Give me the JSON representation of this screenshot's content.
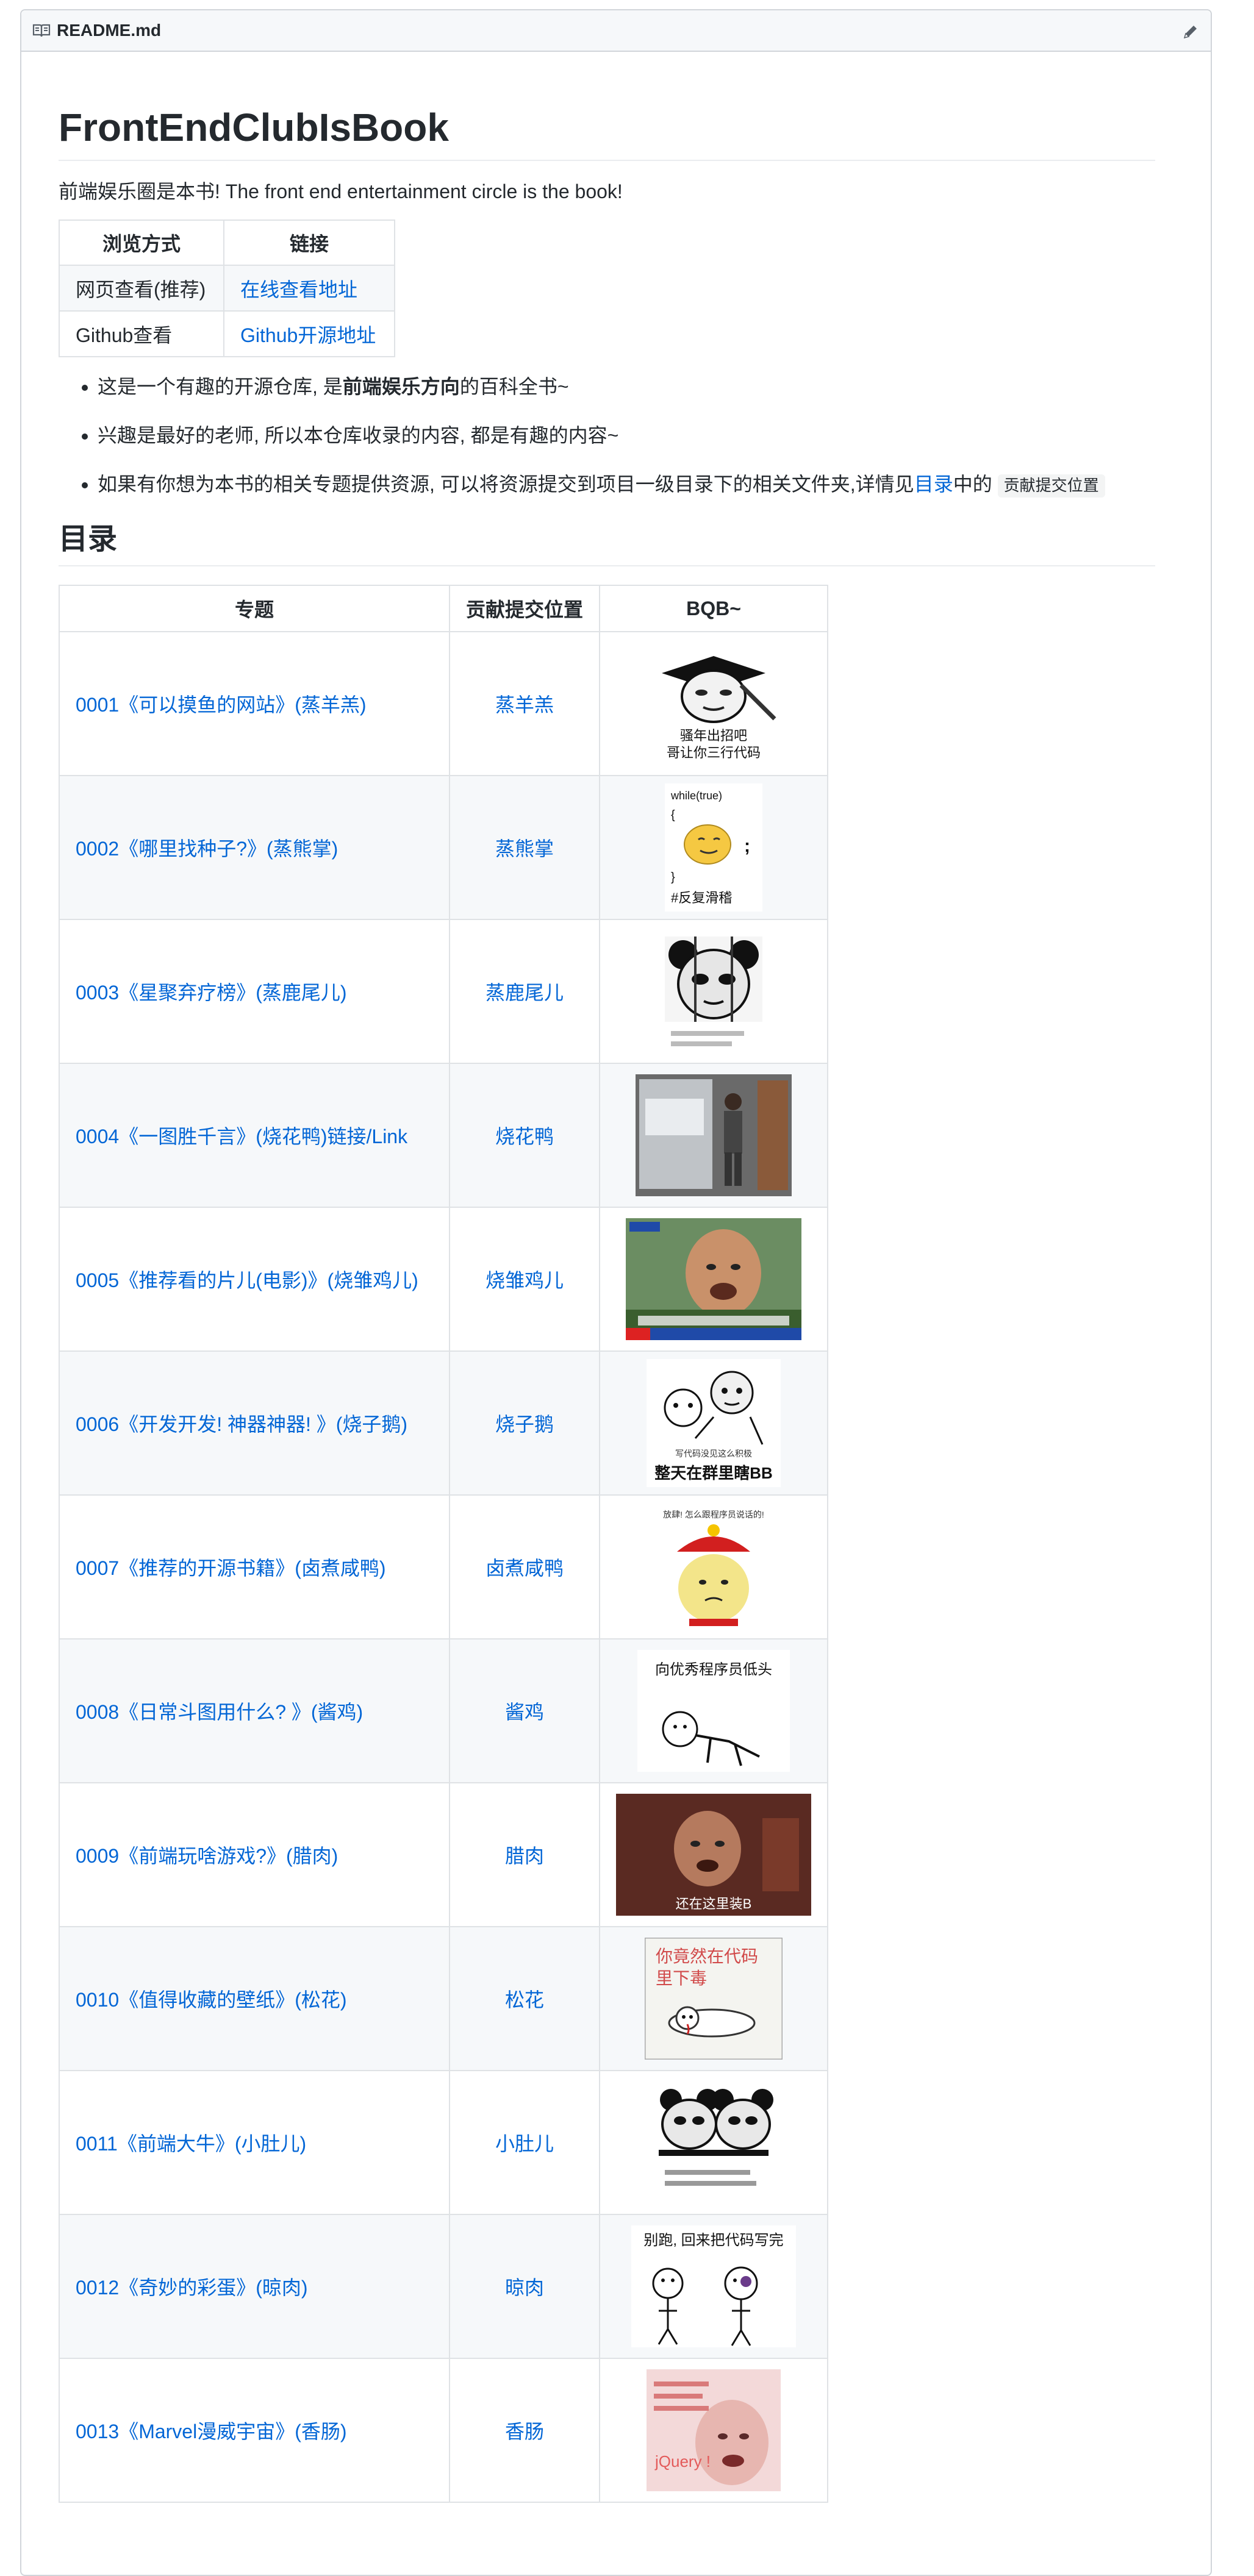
{
  "header": {
    "file_name": "README.md"
  },
  "article": {
    "title": "FrontEndClubIsBook",
    "intro": "前端娱乐圈是本书! The front end entertainment circle is the book!",
    "view_table": {
      "headers": [
        "浏览方式",
        "链接"
      ],
      "rows": [
        {
          "mode": "网页查看(推荐)",
          "link": "在线查看地址"
        },
        {
          "mode": "Github查看",
          "link": "Github开源地址"
        }
      ]
    },
    "bullets": [
      {
        "pre": "这是一个有趣的开源仓库, 是",
        "bold": "前端娱乐方向",
        "post": "的百科全书~"
      },
      {
        "text": "兴趣是最好的老师, 所以本仓库收录的内容, 都是有趣的内容~"
      },
      {
        "pre": "如果有你想为本书的相关专题提供资源, 可以将资源提交到项目一级目录下的相关文件夹,详情见",
        "link": "目录",
        "mid": "中的",
        "code": "贡献提交位置"
      }
    ],
    "toc_heading": "目录",
    "toc_table": {
      "headers": [
        "专题",
        "贡献提交位置",
        "BQB~"
      ],
      "rows": [
        {
          "topic": "0001《可以摸鱼的网站》(蒸羊羔)",
          "contributor": "蒸羊羔",
          "meme_caption": "骚年出招吧 哥让你三行代码"
        },
        {
          "topic": "0002《哪里找种子?》(蒸熊掌)",
          "contributor": "蒸熊掌",
          "meme_caption": "#反复滑稽"
        },
        {
          "topic": "0003《星聚弃疗榜》(蒸鹿尾儿)",
          "contributor": "蒸鹿尾儿",
          "meme_caption": ""
        },
        {
          "topic": "0004《一图胜千言》(烧花鸭)链接/Link",
          "contributor": "烧花鸭",
          "meme_caption": ""
        },
        {
          "topic": "0005《推荐看的片儿(电影)》(烧雏鸡儿)",
          "contributor": "烧雏鸡儿",
          "meme_caption": ""
        },
        {
          "topic": "0006《开发开发! 神器神器! 》(烧子鹅)",
          "contributor": "烧子鹅",
          "meme_caption": "整天在群里瞎BB"
        },
        {
          "topic": "0007《推荐的开源书籍》(卤煮咸鸭)",
          "contributor": "卤煮咸鸭",
          "meme_caption": ""
        },
        {
          "topic": "0008《日常斗图用什么? 》(酱鸡)",
          "contributor": "酱鸡",
          "meme_caption": "向优秀程序员低头"
        },
        {
          "topic": "0009《前端玩啥游戏?》(腊肉)",
          "contributor": "腊肉",
          "meme_caption": "还在这里装B"
        },
        {
          "topic": "0010《值得收藏的壁纸》(松花)",
          "contributor": "松花",
          "meme_caption": "你竟然在代码里下毒"
        },
        {
          "topic": "0011《前端大牛》(小肚儿)",
          "contributor": "小肚儿",
          "meme_caption": ""
        },
        {
          "topic": "0012《奇妙的彩蛋》(晾肉)",
          "contributor": "晾肉",
          "meme_caption": "别跑, 回来把代码写完"
        },
        {
          "topic": "0013《Marvel漫威宇宙》(香肠)",
          "contributor": "香肠",
          "meme_caption": "jQuery !"
        }
      ]
    }
  },
  "colors": {
    "link": "#0366d6",
    "border": "#dfe2e5",
    "stripe": "#f6f8fa"
  },
  "icons": [
    "book-icon",
    "pencil-icon"
  ]
}
